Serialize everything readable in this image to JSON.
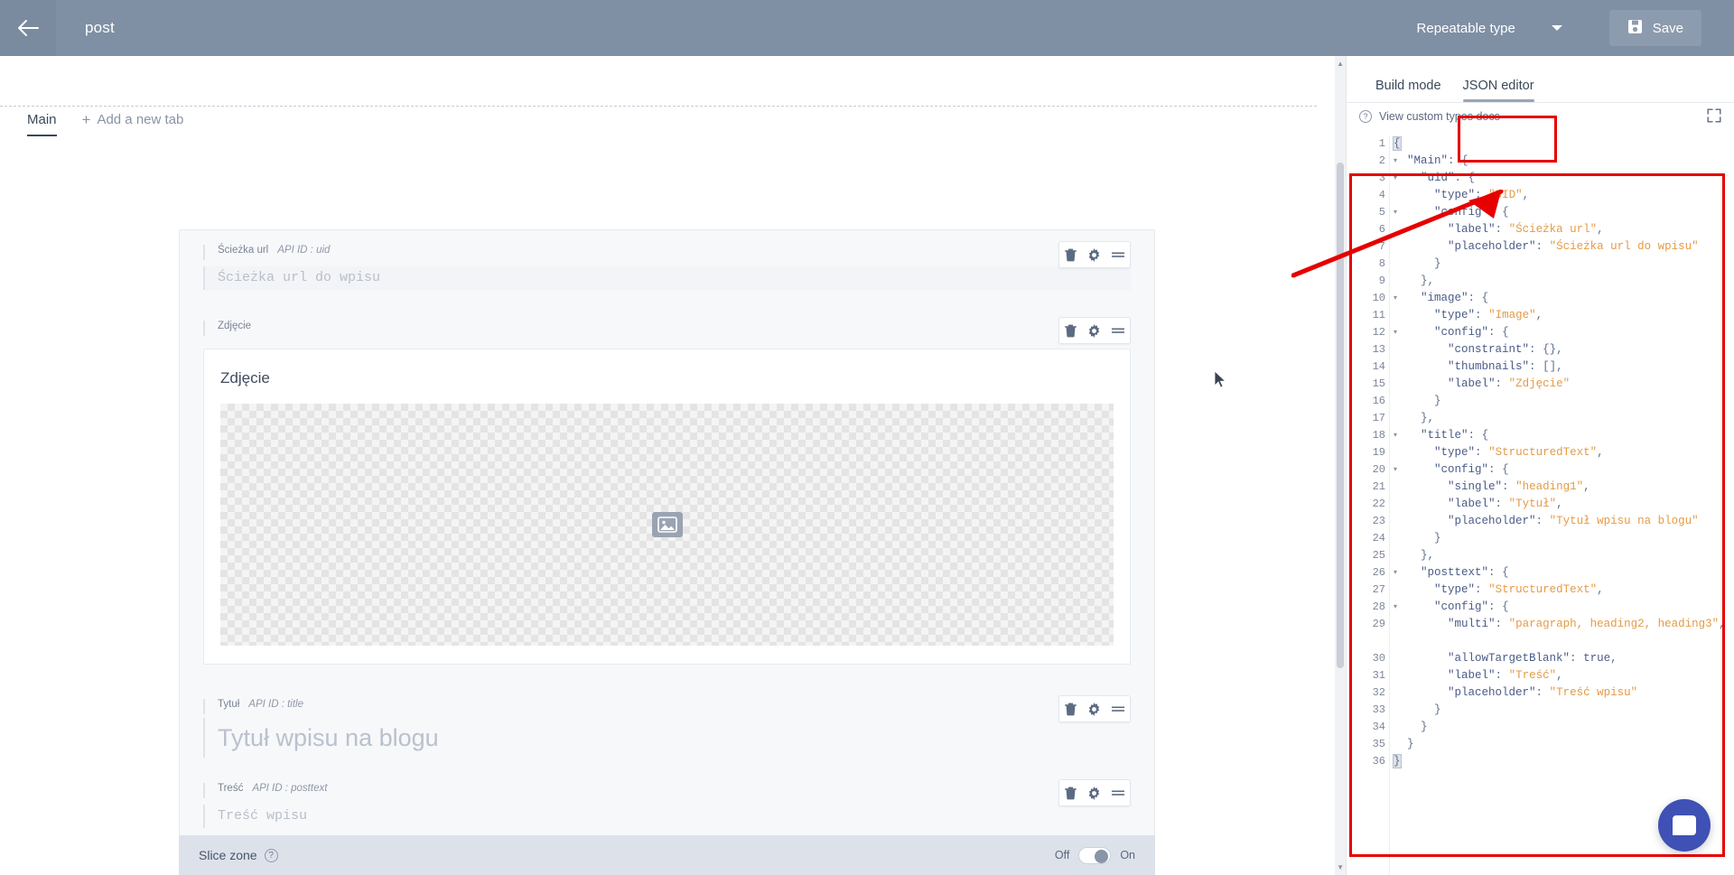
{
  "topbar": {
    "back_icon": "arrow-left-icon",
    "document_title": "post",
    "type_selector_label": "Repeatable type",
    "caret_icon": "chevron-down-icon",
    "save_label": "Save",
    "save_icon": "floppy-disk-icon",
    "bar_color": "#7f8fa4"
  },
  "tabs": {
    "main_label": "Main",
    "add_tab_label": "Add a new tab",
    "add_tab_icon": "plus-icon"
  },
  "fields": [
    {
      "label": "Ścieżka url",
      "api_id": "API ID : uid",
      "placeholder": "Ścieżka url do wpisu",
      "actions": [
        "trash-icon",
        "gear-icon",
        "drag-handle-icon"
      ]
    },
    {
      "label": "Zdjęcie",
      "api_id": "",
      "preview_title": "Zdjęcie",
      "placeholder_icon": "image-placeholder-icon",
      "actions": [
        "trash-icon",
        "gear-icon",
        "drag-handle-icon"
      ]
    },
    {
      "label": "Tytuł",
      "api_id": "API ID : title",
      "placeholder": "Tytuł wpisu na blogu",
      "actions": [
        "trash-icon",
        "gear-icon",
        "drag-handle-icon"
      ]
    },
    {
      "label": "Treść",
      "api_id": "API ID : posttext",
      "placeholder": "Treść wpisu",
      "actions": [
        "trash-icon",
        "gear-icon",
        "drag-handle-icon"
      ]
    }
  ],
  "slice_zone": {
    "label": "Slice zone",
    "help_icon": "question-mark-icon",
    "off_label": "Off",
    "on_label": "On",
    "state": "Off"
  },
  "right_panel": {
    "tabs": [
      {
        "label": "Build mode",
        "active": false
      },
      {
        "label": "JSON editor",
        "active": true
      }
    ],
    "docs_link": "View custom types docs",
    "docs_icon": "question-mark-icon",
    "expand_icon": "expand-arrows-icon"
  },
  "editor": {
    "line_numbers": [
      1,
      2,
      3,
      4,
      5,
      6,
      7,
      8,
      9,
      10,
      11,
      12,
      13,
      14,
      15,
      16,
      17,
      18,
      19,
      20,
      21,
      22,
      23,
      24,
      25,
      26,
      27,
      28,
      29,
      30,
      31,
      32,
      33,
      34,
      35,
      36
    ],
    "fold_lines": [
      1,
      2,
      3,
      5,
      10,
      12,
      18,
      20,
      26,
      28
    ],
    "lines": [
      "{",
      "  \"Main\": {",
      "    \"uid\": {",
      "      \"type\": \"UID\",",
      "      \"config\": {",
      "        \"label\": \"Ścieżka url\",",
      "        \"placeholder\": \"Ścieżka url do wpisu\"",
      "      }",
      "    },",
      "    \"image\": {",
      "      \"type\": \"Image\",",
      "      \"config\": {",
      "        \"constraint\": {},",
      "        \"thumbnails\": [],",
      "        \"label\": \"Zdjęcie\"",
      "      }",
      "    },",
      "    \"title\": {",
      "      \"type\": \"StructuredText\",",
      "      \"config\": {",
      "        \"single\": \"heading1\",",
      "        \"label\": \"Tytuł\",",
      "        \"placeholder\": \"Tytuł wpisu na blogu\"",
      "      }",
      "    },",
      "    \"posttext\": {",
      "      \"type\": \"StructuredText\",",
      "      \"config\": {",
      "        \"multi\": \"paragraph, heading2, heading3\",",
      "        \"allowTargetBlank\": true,",
      "        \"label\": \"Treść\",",
      "        \"placeholder\": \"Treść wpisu\"",
      "      }",
      "    }",
      "  }",
      "}"
    ]
  },
  "annotations": {
    "highlight_color": "#e60000",
    "rects": [
      "json-editor-tab",
      "json-editor-body"
    ],
    "arrow": "annotation-arrow"
  },
  "support": {
    "icon": "chat-bubble-icon",
    "color": "#3f51b5"
  }
}
